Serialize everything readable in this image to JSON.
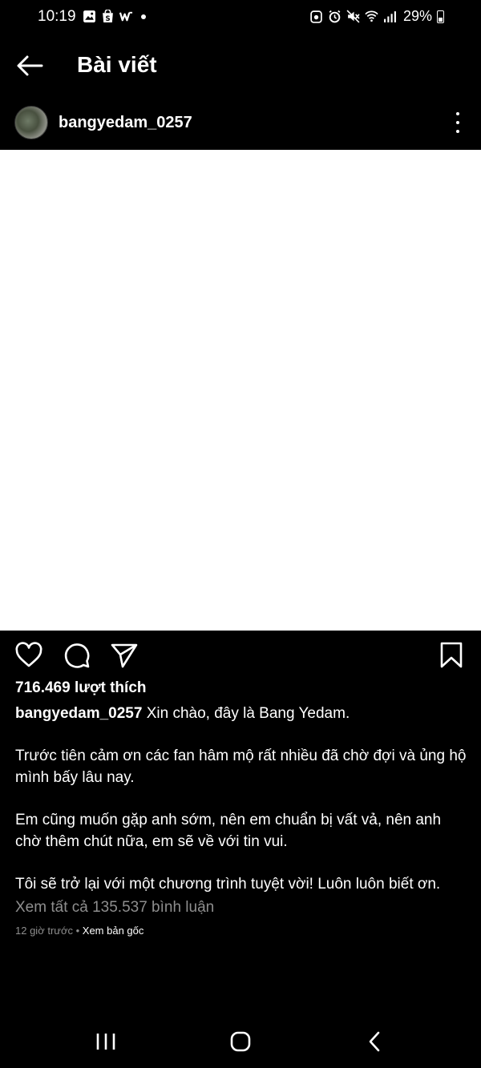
{
  "status_bar": {
    "time": "10:19",
    "battery": "29%",
    "left_icons": [
      "image-icon",
      "shop-icon",
      "w-app-icon",
      "dot-icon"
    ],
    "right_icons": [
      "bixby-icon",
      "alarm-icon",
      "mute-icon",
      "wifi-icon",
      "signal-icon",
      "battery-icon"
    ]
  },
  "header": {
    "title": "Bài viết"
  },
  "post": {
    "username": "bangyedam_0257",
    "likes": "716.469 lượt thích",
    "caption_username": "bangyedam_0257",
    "caption_line1": " Xin chào, đây là Bang Yedam.",
    "caption_para2": "Trước tiên cảm ơn các fan hâm mộ rất nhiều đã chờ đợi và ủng hộ mình bấy lâu nay.",
    "caption_para3": "Em cũng muốn gặp anh sớm, nên em chuẩn bị vất vả, nên anh chờ thêm chút nữa, em sẽ về với tin vui.",
    "caption_para4": "Tôi sẽ trở lại với một chương trình tuyệt vời! Luôn luôn biết ơn.",
    "view_comments": "Xem tất cả 135.537 bình luận",
    "time_ago": "12 giờ trước",
    "separator": " • ",
    "see_original": "Xem bản gốc"
  },
  "colors": {
    "background": "#000000",
    "text": "#ffffff",
    "muted": "#8e8e8e",
    "image_placeholder": "#ffffff"
  }
}
